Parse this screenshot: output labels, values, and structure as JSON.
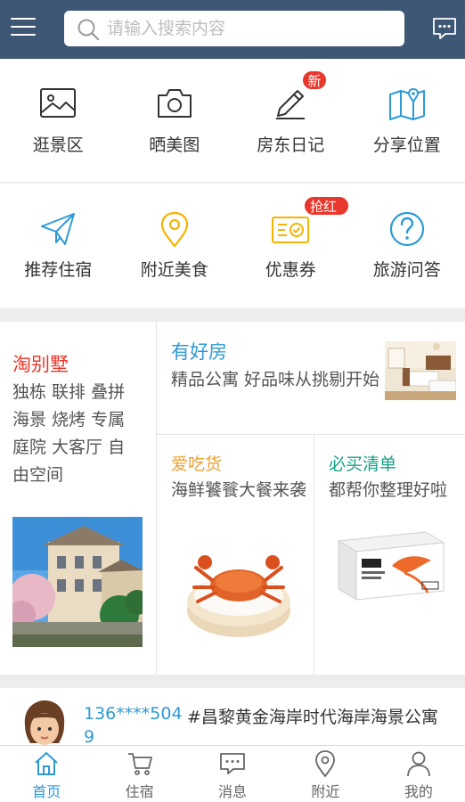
{
  "search": {
    "placeholder": "请输入搜索内容"
  },
  "icons": {
    "menu": "menu-icon",
    "search": "search-icon",
    "message": "message-icon"
  },
  "row1": [
    {
      "label": "逛景区",
      "icon": "picture-icon"
    },
    {
      "label": "晒美图",
      "icon": "camera-icon"
    },
    {
      "label": "房东日记",
      "icon": "pen-icon",
      "badge": "新"
    },
    {
      "label": "分享位置",
      "icon": "map-icon"
    }
  ],
  "row2": [
    {
      "label": "推荐住宿",
      "icon": "paper-plane-icon"
    },
    {
      "label": "附近美食",
      "icon": "location-pin-icon"
    },
    {
      "label": "优惠券",
      "icon": "coupon-icon",
      "badge": "抢红包"
    },
    {
      "label": "旅游问答",
      "icon": "question-icon"
    }
  ],
  "promo": {
    "villa": {
      "title": "淘别墅",
      "desc": "独栋 联排 叠拼 海景 烧烤 专属庭院 大客厅 自由空间"
    },
    "house": {
      "title": "有好房",
      "desc": "精品公寓 好品味从挑剔开始"
    },
    "food": {
      "title": "爱吃货",
      "desc": "海鲜饕餮大餐来袭"
    },
    "list": {
      "title": "必买清单",
      "desc": "都帮你整理好啦"
    }
  },
  "review": {
    "phone": "136****504",
    "phone_cut": "9",
    "title": "#昌黎黄金海岸时代海岸海景公寓"
  },
  "tabs": [
    {
      "label": "首页",
      "icon": "home-icon",
      "active": true
    },
    {
      "label": "住宿",
      "icon": "cart-icon"
    },
    {
      "label": "消息",
      "icon": "message-icon"
    },
    {
      "label": "附近",
      "icon": "location-pin-icon"
    },
    {
      "label": "我的",
      "icon": "user-icon"
    }
  ],
  "colors": {
    "topbar": "#3d5775",
    "accent_blue": "#2d9ad6",
    "accent_red": "#e8372c",
    "food_orange": "#f0a030",
    "list_green": "#17a087",
    "coupon_yellow": "#f5b400"
  }
}
